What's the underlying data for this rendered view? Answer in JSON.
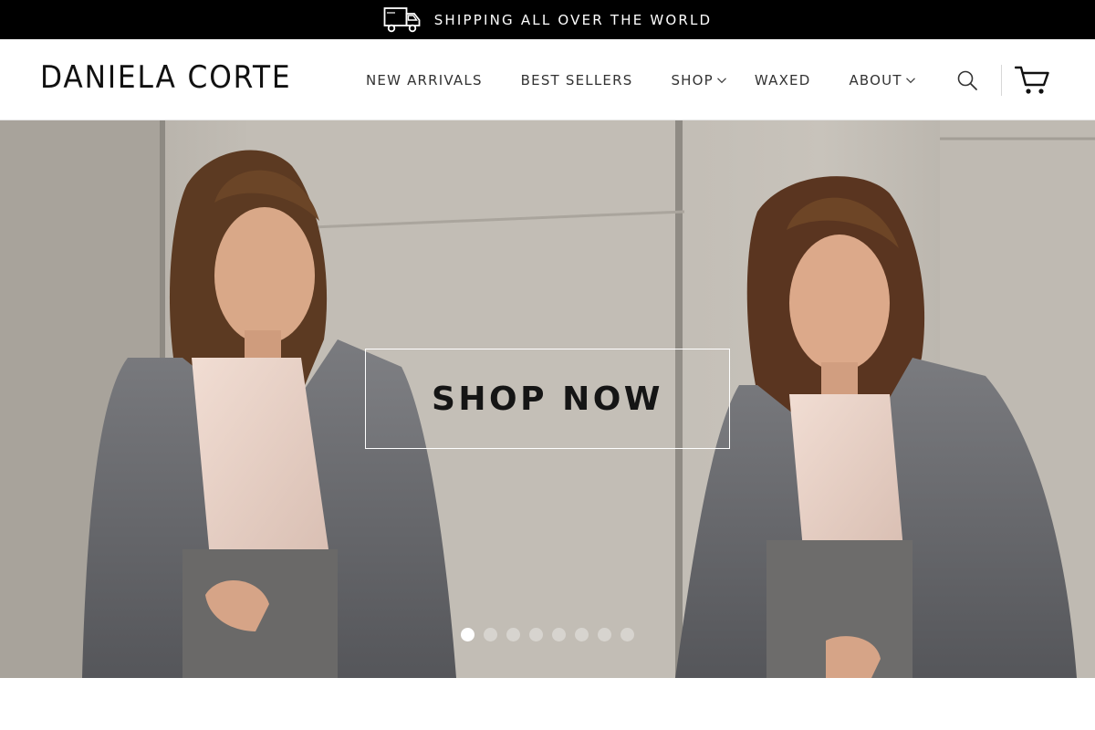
{
  "announcement": {
    "text": "SHIPPING ALL OVER THE WORLD",
    "icon": "truck-icon"
  },
  "header": {
    "logo": "DANIELA CORTE",
    "nav": [
      {
        "label": "NEW ARRIVALS",
        "has_dropdown": false
      },
      {
        "label": "BEST SELLERS",
        "has_dropdown": false
      },
      {
        "label": "SHOP",
        "has_dropdown": true
      },
      {
        "label": "WAXED",
        "has_dropdown": false
      },
      {
        "label": "ABOUT",
        "has_dropdown": true
      }
    ],
    "icons": [
      "search-icon",
      "cart-icon"
    ]
  },
  "hero": {
    "cta_label": "SHOP NOW",
    "slides_total": 8,
    "active_slide": 1
  },
  "colors": {
    "announcement_bg": "#000000",
    "header_bg": "#ffffff",
    "text": "#333333",
    "cta_text": "#151515"
  }
}
